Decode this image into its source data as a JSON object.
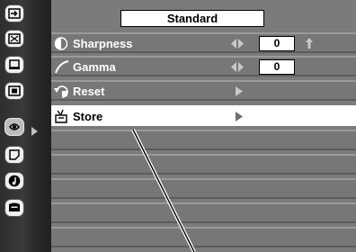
{
  "window": {
    "mode_label": "Standard"
  },
  "sidebar": {
    "icons": [
      {
        "name": "input-icon",
        "active": false
      },
      {
        "name": "computer-adjust-icon",
        "active": false
      },
      {
        "name": "image-select-icon",
        "active": false
      },
      {
        "name": "screen-icon",
        "active": false
      },
      {
        "name": "image-adjust-icon",
        "active": true
      },
      {
        "name": "setting-icon",
        "active": false
      },
      {
        "name": "sound-icon",
        "active": false
      },
      {
        "name": "information-icon",
        "active": false
      }
    ]
  },
  "menu": {
    "items": [
      {
        "label": "Sharpness",
        "icon": "sharpness-icon",
        "value": "0",
        "has_arrows": true,
        "has_up_arrow": true
      },
      {
        "label": "Gamma",
        "icon": "gamma-icon",
        "value": "0",
        "has_arrows": true,
        "has_up_arrow": false
      },
      {
        "label": "Reset",
        "icon": "reset-icon",
        "submenu": true
      },
      {
        "label": "Store",
        "icon": "store-icon",
        "submenu": true,
        "selected": true
      }
    ]
  },
  "colors": {
    "panel_bg": "#7b7b7b",
    "selected_bg": "#ffffff",
    "text": "#ffffff"
  }
}
